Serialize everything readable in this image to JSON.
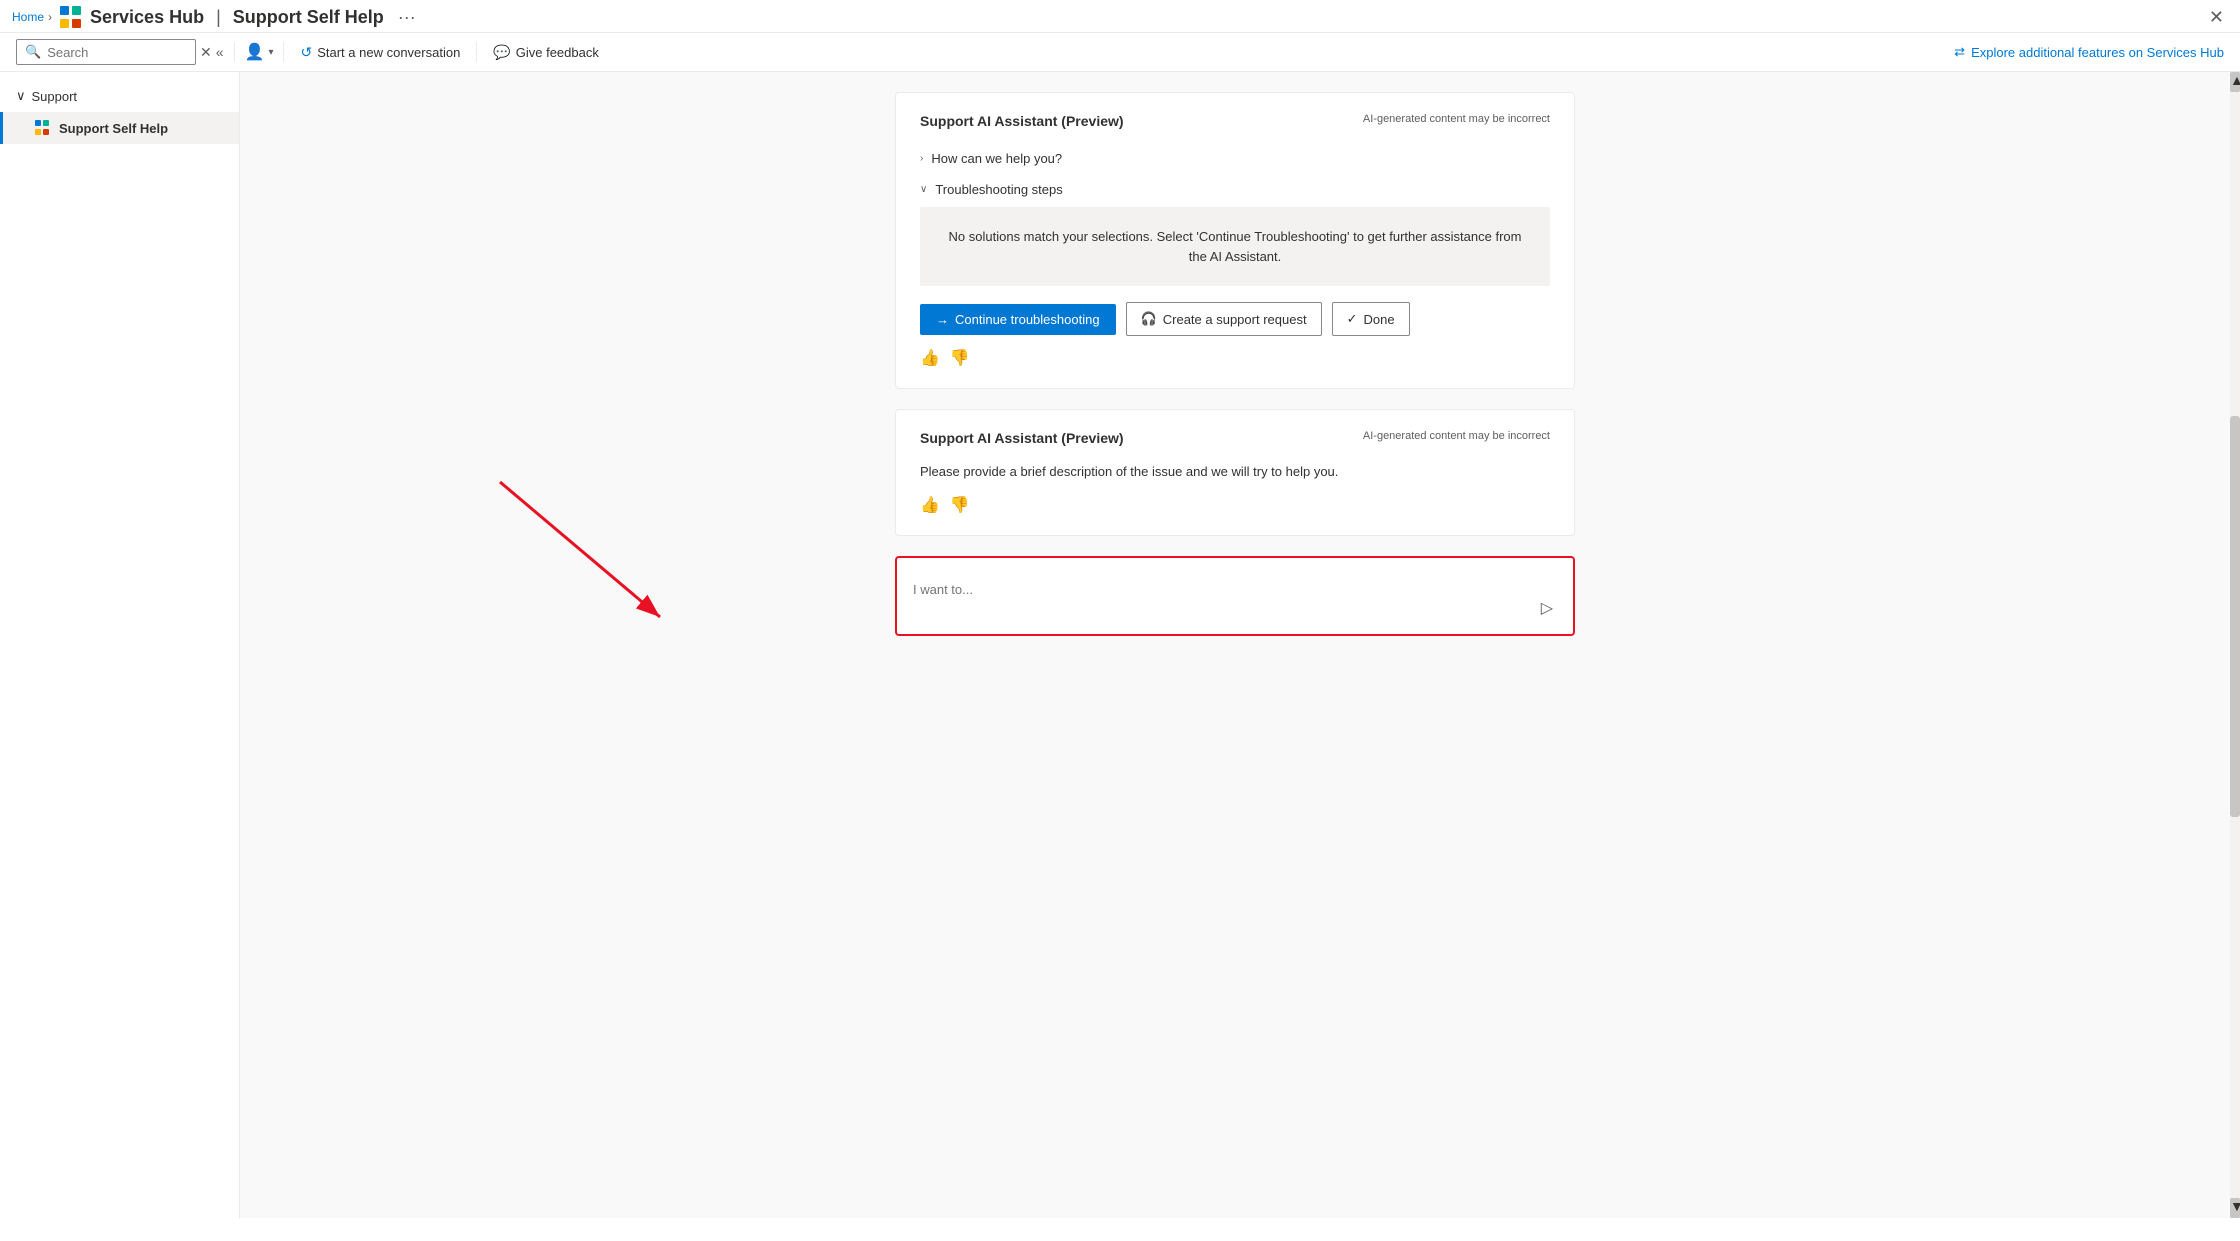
{
  "breadcrumb": {
    "home": "Home",
    "sep": "›"
  },
  "titlebar": {
    "logo_squares": [
      "tl",
      "tr",
      "bl",
      "br"
    ],
    "app_name": "Services Hub",
    "sep": "|",
    "section": "Support Self Help",
    "ellipsis": "···",
    "close": "✕"
  },
  "toolbar": {
    "search_placeholder": "Search",
    "x_label": "✕",
    "collapse_label": "«",
    "person_icon": "👤",
    "chevron": "▾",
    "new_conversation": "Start a new conversation",
    "give_feedback": "Give feedback",
    "explore_label": "Explore additional features on Services Hub"
  },
  "sidebar": {
    "group_label": "Support",
    "chevron_down": "∨",
    "active_item": "Support Self Help"
  },
  "card1": {
    "title": "Support AI Assistant (Preview)",
    "ai_badge": "AI-generated content may be incorrect",
    "section1_label": "How can we help you?",
    "section1_icon_collapsed": "›",
    "section2_label": "Troubleshooting steps",
    "section2_icon_expanded": "∨",
    "no_solutions_text": "No solutions match your selections. Select 'Continue Troubleshooting' to get further assistance from the AI Assistant.",
    "btn_continue": "Continue troubleshooting",
    "btn_arrow": "→",
    "btn_support": "Create a support request",
    "btn_support_icon": "🎧",
    "btn_done": "Done",
    "btn_done_icon": "✓",
    "thumb_up": "👍",
    "thumb_down": "👎"
  },
  "card2": {
    "title": "Support AI Assistant (Preview)",
    "ai_badge": "AI-generated content may be incorrect",
    "description": "Please provide a brief description of the issue and we will try to help you.",
    "thumb_up": "👍",
    "thumb_down": "👎"
  },
  "input_area": {
    "placeholder": "I want to...",
    "send_icon": "▷"
  }
}
